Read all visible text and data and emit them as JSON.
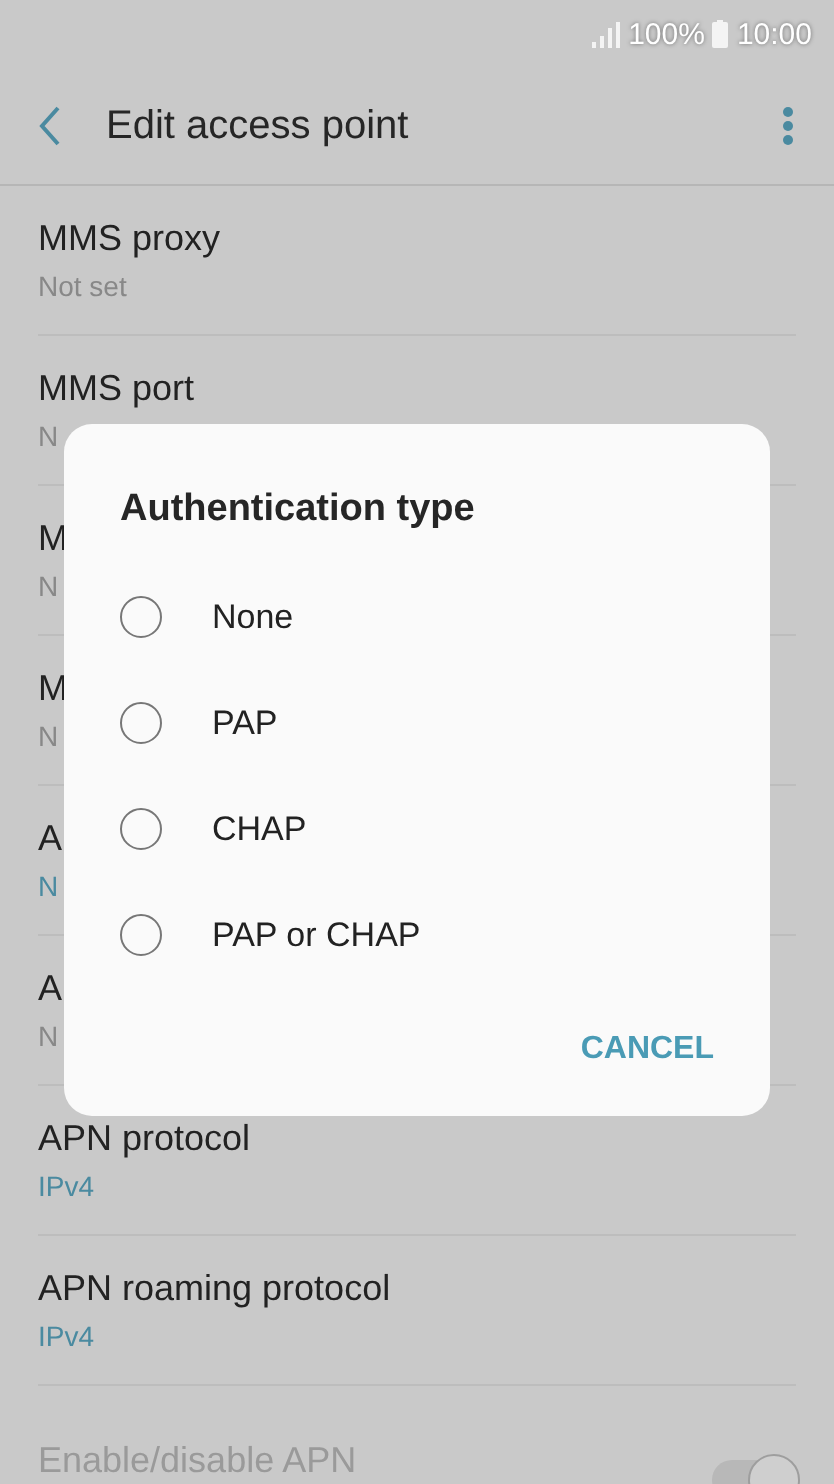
{
  "status_bar": {
    "battery": "100%",
    "time": "10:00"
  },
  "header": {
    "title": "Edit access point"
  },
  "settings": [
    {
      "title": "MMS proxy",
      "value": "Not set",
      "kind": "plain"
    },
    {
      "title": "MMS port",
      "value": "N",
      "kind": "plain"
    },
    {
      "title": "M",
      "value": "N",
      "kind": "plain"
    },
    {
      "title": "M",
      "value": "N",
      "kind": "plain"
    },
    {
      "title": "A",
      "value": "N",
      "kind": "accent"
    },
    {
      "title": "A",
      "value": "N",
      "kind": "plain"
    },
    {
      "title": "APN protocol",
      "value": "IPv4",
      "kind": "accent"
    },
    {
      "title": "APN roaming protocol",
      "value": "IPv4",
      "kind": "accent"
    },
    {
      "title": "Enable/disable APN",
      "kind": "toggle",
      "disabled": true,
      "on": true
    }
  ],
  "dialog": {
    "title": "Authentication type",
    "options": [
      {
        "label": "None",
        "selected": false
      },
      {
        "label": "PAP",
        "selected": false
      },
      {
        "label": "CHAP",
        "selected": false
      },
      {
        "label": "PAP or CHAP",
        "selected": false
      }
    ],
    "button": "CANCEL"
  }
}
